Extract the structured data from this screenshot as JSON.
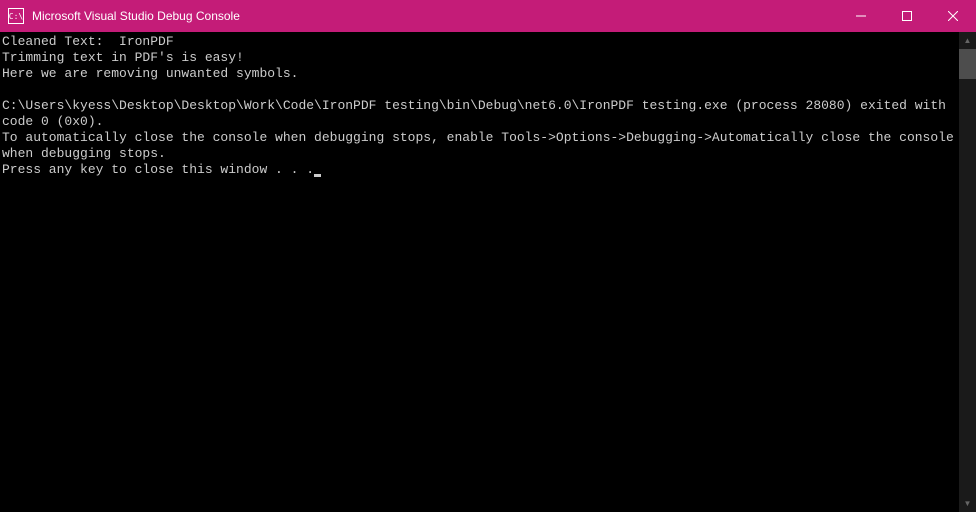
{
  "titlebar": {
    "icon_text": "C:\\",
    "title": "Microsoft Visual Studio Debug Console"
  },
  "console": {
    "lines": [
      "Cleaned Text:  IronPDF",
      "Trimming text in PDF's is easy!",
      "Here we are removing unwanted symbols.",
      "",
      "C:\\Users\\kyess\\Desktop\\Desktop\\Work\\Code\\IronPDF testing\\bin\\Debug\\net6.0\\IronPDF testing.exe (process 28080) exited with code 0 (0x0).",
      "To automatically close the console when debugging stops, enable Tools->Options->Debugging->Automatically close the console when debugging stops.",
      "Press any key to close this window . . ."
    ]
  }
}
